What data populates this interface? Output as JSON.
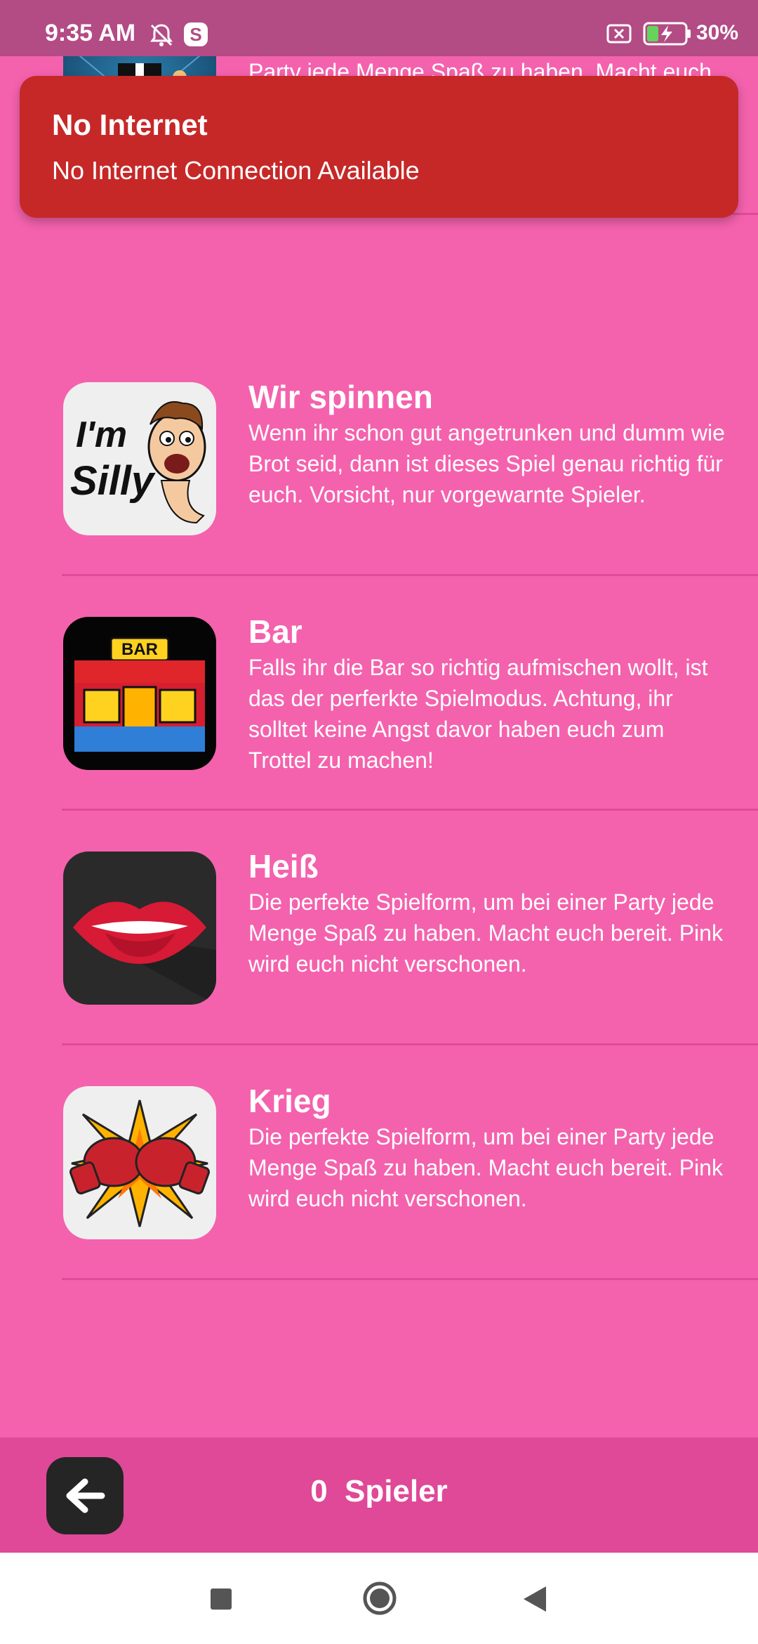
{
  "status_bar": {
    "time": "9:35 AM",
    "icons": [
      "bell-off-icon",
      "s-app-icon",
      "no-sim-icon",
      "battery-charging-icon"
    ],
    "battery": "30%"
  },
  "toast": {
    "title": "No Internet",
    "message": "No Internet Connection Available",
    "color": "#c62828"
  },
  "game_modes": [
    {
      "title": "",
      "description": "Party jede Menge Spaß zu haben. Macht euch bereit, Coco Jambo wird euch nicht verschonen.",
      "icon": "dancer-icon"
    },
    {
      "title": "Wir spinnen",
      "description": "Wenn ihr schon gut angetrunken und dumm wie Brot seid, dann ist dieses Spiel genau richtig für euch. Vorsicht, nur vorgewarnte Spieler.",
      "icon": "silly-face-icon",
      "icon_text_line1": "I'm",
      "icon_text_line2": "Silly"
    },
    {
      "title": "Bar",
      "description": "Falls ihr die Bar so richtig aufmischen wollt, ist das der perferkte Spielmodus. Achtung, ihr solltet keine Angst davor haben euch zum Trottel zu machen!",
      "icon": "bar-building-icon",
      "icon_text": "BAR"
    },
    {
      "title": "Heiß",
      "description": "Die perfekte Spielform, um bei einer Party jede Menge Spaß zu haben. Macht euch bereit. Pink wird euch nicht verschonen.",
      "icon": "lips-icon"
    },
    {
      "title": "Krieg",
      "description": "Die perfekte Spielform, um bei einer Party jede Menge Spaß zu haben. Macht euch bereit. Pink wird euch nicht verschonen.",
      "icon": "boxing-gloves-icon"
    }
  ],
  "bottom_bar": {
    "player_count": "0",
    "player_label": "Spieler"
  },
  "colors": {
    "background": "#f462ad",
    "bottom_bar": "#df4997",
    "status_bar": "#b34b85"
  }
}
